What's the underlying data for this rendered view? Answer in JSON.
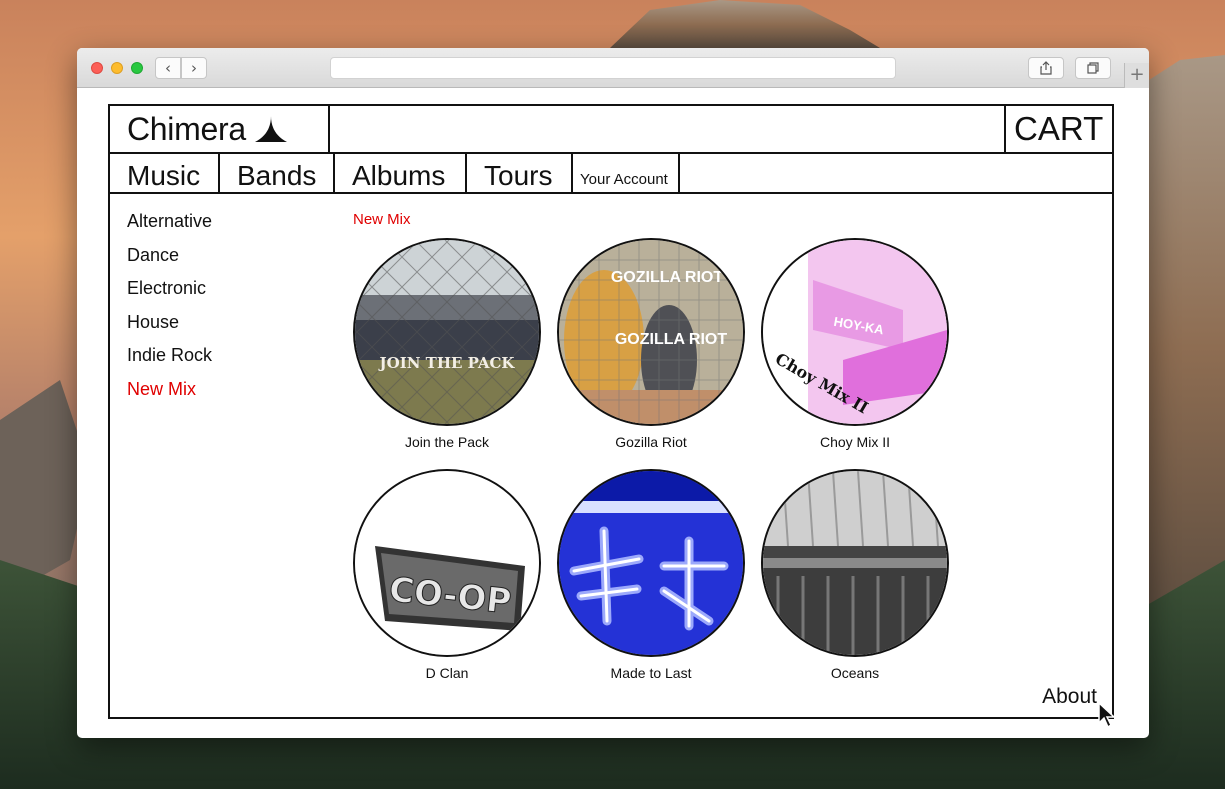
{
  "site": {
    "brand": "Chimera",
    "cart_label": "CART",
    "nav": [
      "Music",
      "Bands",
      "Albums",
      "Tours",
      "Your Account"
    ],
    "genres": [
      "Alternative",
      "Dance",
      "Electronic",
      "House",
      "Indie Rock",
      "New Mix"
    ],
    "active_genre": "New Mix",
    "breadcrumb": "New Mix",
    "albums": [
      {
        "title": "Join the Pack",
        "cover_text": "JOIN THE PACK"
      },
      {
        "title": "Gozilla Riot",
        "cover_text_1": "GOZILLA RIOT",
        "cover_text_2": "GOZILLA RIOT"
      },
      {
        "title": "Choy Mix II",
        "cover_text": "Choy Mix II",
        "cover_sign": "HOY-KA"
      },
      {
        "title": "D Clan",
        "cover_text": "CO-OP"
      },
      {
        "title": "Made to Last"
      },
      {
        "title": "Oceans"
      }
    ],
    "footer_link": "About"
  },
  "colors": {
    "accent": "#e00000",
    "ink": "#111111"
  }
}
